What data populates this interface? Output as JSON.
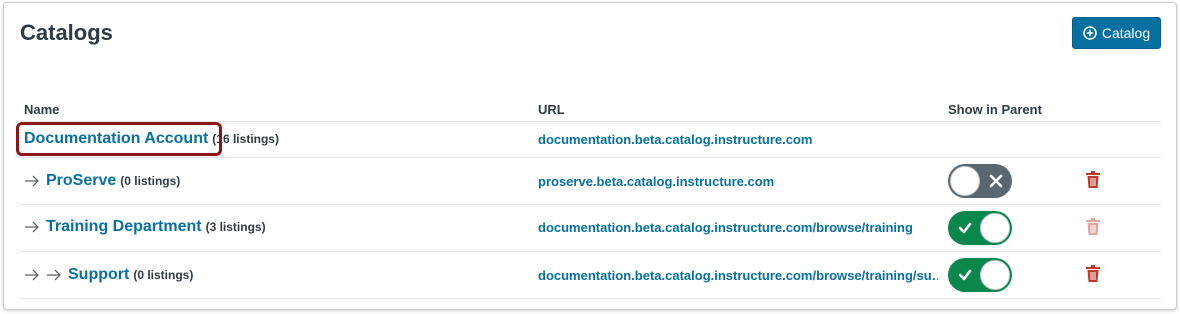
{
  "page": {
    "title": "Catalogs"
  },
  "toolbar": {
    "add_label": "Catalog",
    "add_icon": "plus-circle-icon"
  },
  "table": {
    "headers": {
      "name": "Name",
      "url": "URL",
      "show_in_parent": "Show in Parent"
    },
    "rows": [
      {
        "name": "Documentation Account",
        "listings": "(16 listings)",
        "url": "documentation.beta.catalog.instructure.com",
        "depth": 0,
        "show_in_parent": null,
        "deletable": false
      },
      {
        "name": "ProServe",
        "listings": "(0 listings)",
        "url": "proserve.beta.catalog.instructure.com",
        "depth": 1,
        "show_in_parent": false,
        "deletable": true
      },
      {
        "name": "Training Department",
        "listings": "(3 listings)",
        "url": "documentation.beta.catalog.instructure.com/browse/training",
        "depth": 1,
        "show_in_parent": true,
        "deletable": "faded"
      },
      {
        "name": "Support",
        "listings": "(0 listings)",
        "url": "documentation.beta.catalog.instructure.com/browse/training/su…",
        "depth": 2,
        "show_in_parent": true,
        "deletable": true
      }
    ]
  },
  "colors": {
    "link": "#0770a3",
    "toggle_on": "#0b874b",
    "toggle_off": "#5a6770",
    "trash": "#c0392b",
    "highlight": "#8c1515"
  }
}
